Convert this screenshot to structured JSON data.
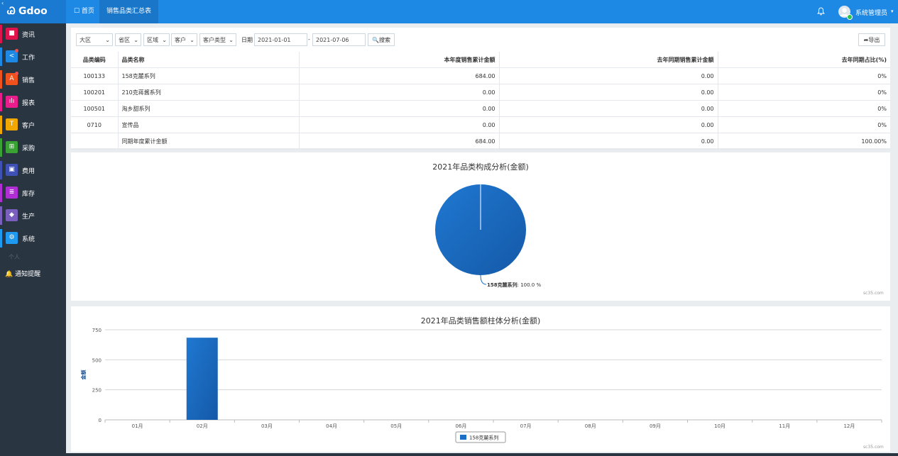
{
  "brand": {
    "mark": "Ꮚ",
    "name": "Gdoo",
    "back_glyph": "‹"
  },
  "topnav": {
    "home": "☐ 首页",
    "active_tab": "销售品类汇总表"
  },
  "user": {
    "name": "系统管理员",
    "caret": "▾",
    "bell": "🔔"
  },
  "sidebar": {
    "items": [
      {
        "label": "资讯",
        "icon": "document-icon",
        "glyph": "■",
        "color": "#e0144c"
      },
      {
        "label": "工作",
        "icon": "share-icon",
        "glyph": "<",
        "color": "#1e88e5"
      },
      {
        "label": "销售",
        "icon": "store-icon",
        "glyph": "A",
        "color": "#f0521e"
      },
      {
        "label": "报表",
        "icon": "chart-icon",
        "glyph": "ılı",
        "color": "#e91e8c"
      },
      {
        "label": "客户",
        "icon": "shirt-icon",
        "glyph": "T",
        "color": "#f0a800"
      },
      {
        "label": "采购",
        "icon": "cart-icon",
        "glyph": "⊞",
        "color": "#3aa135"
      },
      {
        "label": "费用",
        "icon": "money-icon",
        "glyph": "▣",
        "color": "#3f51b5"
      },
      {
        "label": "库存",
        "icon": "list-icon",
        "glyph": "≣",
        "color": "#b02fd4"
      },
      {
        "label": "生产",
        "icon": "cube-icon",
        "glyph": "◆",
        "color": "#7a5fbf"
      },
      {
        "label": "系统",
        "icon": "gears-icon",
        "glyph": "⚙",
        "color": "#1e9bf0"
      }
    ],
    "section": "个人",
    "notify": "通知提醒"
  },
  "filters": {
    "selects": [
      "大区",
      "省区",
      "区域",
      "客户",
      "客户类型"
    ],
    "date_label": "日期",
    "date_from": "2021-01-01",
    "date_to": "2021-07-06",
    "search_label": "🔍搜索",
    "export_label": "➦导出"
  },
  "table": {
    "headers": [
      "品类编码",
      "品类名称",
      "本年度销售累计金额",
      "去年同期销售累计金额",
      "去年同期占比(%)"
    ],
    "rows": [
      [
        "100133",
        "158克麓系列",
        "684.00",
        "0.00",
        "0%"
      ],
      [
        "100201",
        "210克蒋酱系列",
        "0.00",
        "0.00",
        "0%"
      ],
      [
        "100501",
        "淘乡甜系列",
        "0.00",
        "0.00",
        "0%"
      ],
      [
        "0710",
        "宣传品",
        "0.00",
        "0.00",
        "0%"
      ],
      [
        "",
        "同期年度累计金额",
        "684.00",
        "0.00",
        "100.00%"
      ]
    ]
  },
  "pie": {
    "title": "2021年品类构成分析(金额)",
    "label_name": "158克麓系列",
    "label_value": ": 100.0 %",
    "credit": "sc35.com"
  },
  "bar": {
    "title": "2021年品类销售额柱体分析(金额)",
    "ylabel": "金额",
    "legend": "158克麓系列",
    "credit": "sc35.com"
  },
  "colors": {
    "accent": "#1e88e5",
    "series": "#1a6fc4"
  },
  "chart_data": [
    {
      "type": "pie",
      "title": "2021年品类构成分析(金额)",
      "slices": [
        {
          "name": "158克麓系列",
          "value": 100.0
        }
      ]
    },
    {
      "type": "bar",
      "title": "2021年品类销售额柱体分析(金额)",
      "ylabel": "金额",
      "categories": [
        "01月",
        "02月",
        "03月",
        "04月",
        "05月",
        "06月",
        "07月",
        "08月",
        "09月",
        "10月",
        "11月",
        "12月"
      ],
      "series": [
        {
          "name": "158克麓系列",
          "values": [
            0,
            684,
            0,
            0,
            0,
            0,
            0,
            0,
            0,
            0,
            0,
            0
          ]
        }
      ],
      "yticks": [
        0,
        250,
        500,
        750
      ],
      "ylim": [
        0,
        750
      ],
      "grid": true,
      "legend": "bottom-center"
    }
  ]
}
